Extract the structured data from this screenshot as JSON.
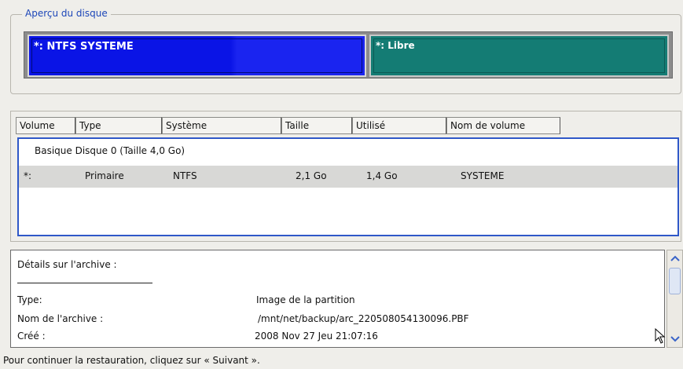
{
  "disk_overview": {
    "legend": "Aperçu du disque",
    "segments": [
      {
        "label": "*: NTFS SYSTEME",
        "color": "#0a14e6"
      },
      {
        "label": "*: Libre",
        "color": "#147c74"
      }
    ]
  },
  "columns": [
    "Volume",
    "Type",
    "Système",
    "Taille",
    "Utilisé",
    "Nom de volume"
  ],
  "group": "Basique Disque 0 (Taille 4,0 Go)",
  "row": {
    "volume": "*:",
    "type": "Primaire",
    "system": "NTFS",
    "size": "2,1 Go",
    "used": "1,4 Go",
    "name": "SYSTEME"
  },
  "details": {
    "heading": "Détails sur l'archive :",
    "fields": [
      {
        "label": "Type:",
        "value": "Image de la partition"
      },
      {
        "label": "Nom de l'archive :",
        "value": "/mnt/net/backup/arc_220508054130096.PBF"
      },
      {
        "label": "Créé :",
        "value": "2008 Nov 27 Jeu 21:07:16"
      }
    ]
  },
  "footer": "Pour continuer la restauration, cliquez sur « Suivant »."
}
